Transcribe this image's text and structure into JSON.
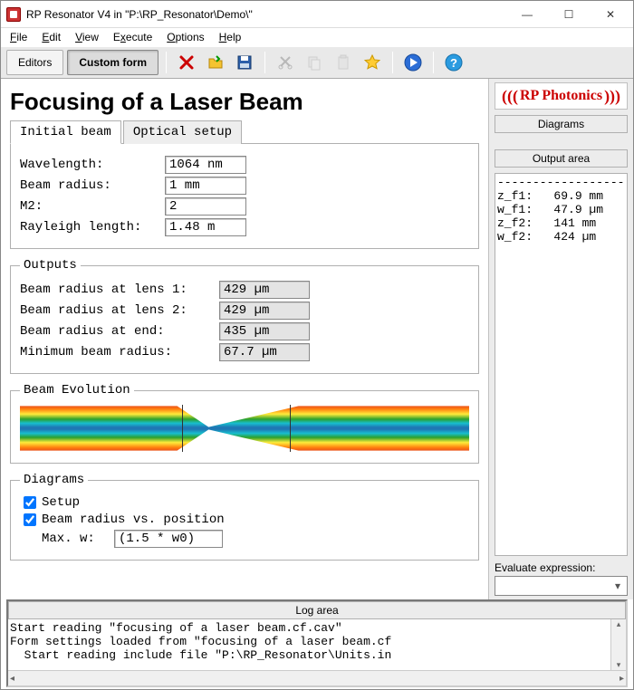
{
  "window": {
    "title": "RP Resonator V4 in \"P:\\RP_Resonator\\Demo\\\"",
    "minimize": "—",
    "maximize": "☐",
    "close": "✕"
  },
  "menu": {
    "file": "File",
    "edit": "Edit",
    "view": "View",
    "execute": "Execute",
    "options": "Options",
    "help": "Help"
  },
  "toolbar": {
    "editors": "Editors",
    "custom_form": "Custom form"
  },
  "page": {
    "title": "Focusing of a Laser Beam"
  },
  "tabs": {
    "initial_beam": "Initial beam",
    "optical_setup": "Optical setup"
  },
  "inputs": {
    "wavelength_label": "Wavelength:",
    "wavelength_value": "1064 nm",
    "beam_radius_label": "Beam radius:",
    "beam_radius_value": "1 mm",
    "m2_label": "M2:",
    "m2_value": "2",
    "rayleigh_label": "Rayleigh length:",
    "rayleigh_value": "1.48 m"
  },
  "outputs": {
    "legend": "Outputs",
    "lens1_label": "Beam radius at lens 1:",
    "lens1_value": "429 µm",
    "lens2_label": "Beam radius at lens 2:",
    "lens2_value": "429 µm",
    "end_label": "Beam radius at end:",
    "end_value": "435 µm",
    "min_label": "Minimum beam radius:",
    "min_value": "67.7 µm"
  },
  "beam_evo": {
    "legend": "Beam Evolution"
  },
  "diagrams": {
    "legend": "Diagrams",
    "setup_label": "Setup",
    "setup_checked": true,
    "bvp_label": "Beam radius vs. position",
    "bvp_checked": true,
    "maxw_label": "Max. w:",
    "maxw_value": "(1.5 * w0)"
  },
  "log": {
    "header": "Log area",
    "lines": "Start reading \"focusing of a laser beam.cf.cav\"\nForm settings loaded from \"focusing of a laser beam.cf\n  Start reading include file \"P:\\RP_Resonator\\Units.in"
  },
  "right": {
    "logo_text": "RP Photonics",
    "diagrams_btn": "Diagrams",
    "output_header": "Output area",
    "output_text": "------------------\nz_f1:   69.9 mm\nw_f1:   47.9 µm\nz_f2:   141 mm\nw_f2:   424 µm",
    "eval_label": "Evaluate expression:"
  }
}
